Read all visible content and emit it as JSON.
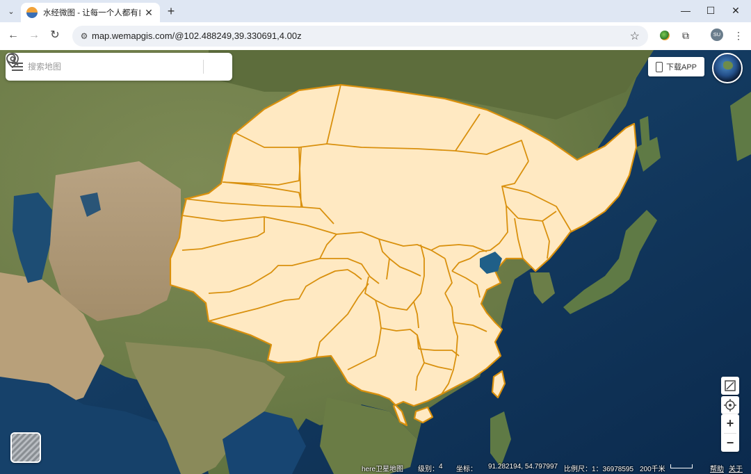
{
  "browser": {
    "tab": {
      "title": "水经微图 - 让每一个人都有自己",
      "close": "✕"
    },
    "new_tab": "+",
    "window": {
      "minimize": "—",
      "maximize": "☐",
      "close": "✕"
    },
    "url": "map.wemapgis.com/@102.488249,39.330691,4.00z",
    "profile_initials": "SU"
  },
  "search": {
    "placeholder": "搜索地图"
  },
  "download_app_label": "下载APP",
  "controls": {
    "zoom_in": "+",
    "zoom_out": "−"
  },
  "status": {
    "source": "here卫星地图",
    "level_label": "级别：",
    "level_value": "4",
    "coord_label": "坐标：",
    "coord_value": "91.282194, 54.797997",
    "scale_label": "比例尺：1：36978595",
    "scale_text": "200千米",
    "help": "帮助",
    "about": "关于"
  },
  "colors": {
    "region_fill": "#ffe9c2",
    "region_stroke": "#d9900d"
  }
}
